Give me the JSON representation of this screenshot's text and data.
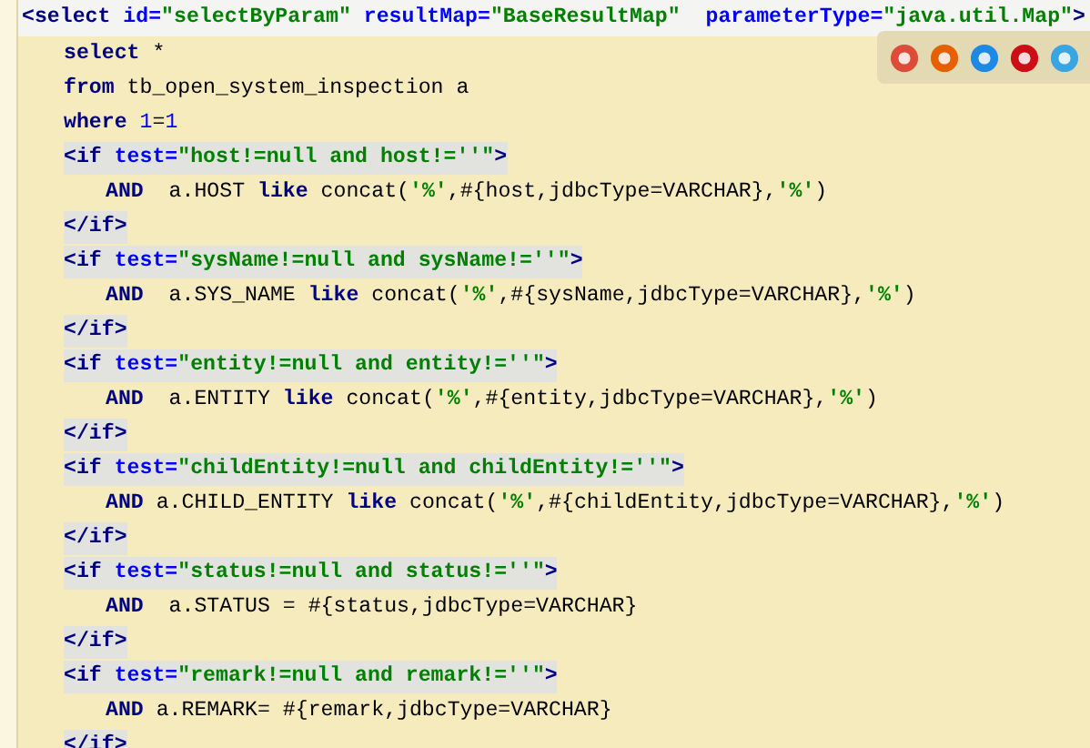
{
  "editor": {
    "lines": [
      {
        "current": true,
        "highlighted": false,
        "tokens": [
          {
            "kind": "tag",
            "text": "<select "
          },
          {
            "kind": "attr",
            "text": "id="
          },
          {
            "kind": "str",
            "text": "\"selectByParam\""
          },
          {
            "kind": "attr",
            "text": " resultMap="
          },
          {
            "kind": "str",
            "text": "\"BaseResultMap\""
          },
          {
            "kind": "attr",
            "text": "  parameterType="
          },
          {
            "kind": "str",
            "text": "\"java.util.Map\""
          },
          {
            "kind": "tag",
            "text": ">"
          }
        ],
        "children": [
          {
            "current": false,
            "highlighted": false,
            "tokens": [
              {
                "kind": "kw",
                "text": "select"
              },
              {
                "kind": "plain",
                "text": " *"
              }
            ]
          },
          {
            "current": false,
            "highlighted": false,
            "tokens": [
              {
                "kind": "kw",
                "text": "from"
              },
              {
                "kind": "plain",
                "text": " tb_open_system_inspection a"
              }
            ]
          },
          {
            "current": false,
            "highlighted": false,
            "tokens": [
              {
                "kind": "kw",
                "text": "where"
              },
              {
                "kind": "num",
                "text": " 1"
              },
              {
                "kind": "plain",
                "text": "="
              },
              {
                "kind": "num",
                "text": "1"
              }
            ]
          },
          {
            "current": false,
            "highlighted": true,
            "tokens": [
              {
                "kind": "tag",
                "text": "<if "
              },
              {
                "kind": "attr",
                "text": "test="
              },
              {
                "kind": "str",
                "text": "\"host!=null and host!=''\""
              },
              {
                "kind": "tag",
                "text": ">"
              }
            ],
            "children": [
              {
                "current": false,
                "highlighted": false,
                "tokens": [
                  {
                    "kind": "kw",
                    "text": "AND"
                  },
                  {
                    "kind": "plain",
                    "text": "  a.HOST "
                  },
                  {
                    "kind": "kw",
                    "text": "like"
                  },
                  {
                    "kind": "plain",
                    "text": " concat("
                  },
                  {
                    "kind": "str",
                    "text": "'%'"
                  },
                  {
                    "kind": "plain",
                    "text": ",#{host,jdbcType=VARCHAR},"
                  },
                  {
                    "kind": "str",
                    "text": "'%'"
                  },
                  {
                    "kind": "plain",
                    "text": ")"
                  }
                ]
              }
            ]
          },
          {
            "current": false,
            "highlighted": true,
            "tokens": [
              {
                "kind": "tag",
                "text": "</if>"
              }
            ]
          },
          {
            "current": false,
            "highlighted": true,
            "tokens": [
              {
                "kind": "tag",
                "text": "<if "
              },
              {
                "kind": "attr",
                "text": "test="
              },
              {
                "kind": "str",
                "text": "\"sysName!=null and sysName!=''\""
              },
              {
                "kind": "tag",
                "text": ">"
              }
            ],
            "children": [
              {
                "current": false,
                "highlighted": false,
                "tokens": [
                  {
                    "kind": "kw",
                    "text": "AND"
                  },
                  {
                    "kind": "plain",
                    "text": "  a.SYS_NAME "
                  },
                  {
                    "kind": "kw",
                    "text": "like"
                  },
                  {
                    "kind": "plain",
                    "text": " concat("
                  },
                  {
                    "kind": "str",
                    "text": "'%'"
                  },
                  {
                    "kind": "plain",
                    "text": ",#{sysName,jdbcType=VARCHAR},"
                  },
                  {
                    "kind": "str",
                    "text": "'%'"
                  },
                  {
                    "kind": "plain",
                    "text": ")"
                  }
                ]
              }
            ]
          },
          {
            "current": false,
            "highlighted": true,
            "tokens": [
              {
                "kind": "tag",
                "text": "</if>"
              }
            ]
          },
          {
            "current": false,
            "highlighted": true,
            "tokens": [
              {
                "kind": "tag",
                "text": "<if "
              },
              {
                "kind": "attr",
                "text": "test="
              },
              {
                "kind": "str",
                "text": "\"entity!=null and entity!=''\""
              },
              {
                "kind": "tag",
                "text": ">"
              }
            ],
            "children": [
              {
                "current": false,
                "highlighted": false,
                "tokens": [
                  {
                    "kind": "kw",
                    "text": "AND"
                  },
                  {
                    "kind": "plain",
                    "text": "  a.ENTITY "
                  },
                  {
                    "kind": "kw",
                    "text": "like"
                  },
                  {
                    "kind": "plain",
                    "text": " concat("
                  },
                  {
                    "kind": "str",
                    "text": "'%'"
                  },
                  {
                    "kind": "plain",
                    "text": ",#{entity,jdbcType=VARCHAR},"
                  },
                  {
                    "kind": "str",
                    "text": "'%'"
                  },
                  {
                    "kind": "plain",
                    "text": ")"
                  }
                ]
              }
            ]
          },
          {
            "current": false,
            "highlighted": true,
            "tokens": [
              {
                "kind": "tag",
                "text": "</if>"
              }
            ]
          },
          {
            "current": false,
            "highlighted": true,
            "tokens": [
              {
                "kind": "tag",
                "text": "<if "
              },
              {
                "kind": "attr",
                "text": "test="
              },
              {
                "kind": "str",
                "text": "\"childEntity!=null and childEntity!=''\""
              },
              {
                "kind": "tag",
                "text": ">"
              }
            ],
            "children": [
              {
                "current": false,
                "highlighted": false,
                "tokens": [
                  {
                    "kind": "kw",
                    "text": "AND"
                  },
                  {
                    "kind": "plain",
                    "text": " a.CHILD_ENTITY "
                  },
                  {
                    "kind": "kw",
                    "text": "like"
                  },
                  {
                    "kind": "plain",
                    "text": " concat("
                  },
                  {
                    "kind": "str",
                    "text": "'%'"
                  },
                  {
                    "kind": "plain",
                    "text": ",#{childEntity,jdbcType=VARCHAR},"
                  },
                  {
                    "kind": "str",
                    "text": "'%'"
                  },
                  {
                    "kind": "plain",
                    "text": ")"
                  }
                ]
              }
            ]
          },
          {
            "current": false,
            "highlighted": true,
            "tokens": [
              {
                "kind": "tag",
                "text": "</if>"
              }
            ]
          },
          {
            "current": false,
            "highlighted": true,
            "tokens": [
              {
                "kind": "tag",
                "text": "<if "
              },
              {
                "kind": "attr",
                "text": "test="
              },
              {
                "kind": "str",
                "text": "\"status!=null and status!=''\""
              },
              {
                "kind": "tag",
                "text": ">"
              }
            ],
            "children": [
              {
                "current": false,
                "highlighted": false,
                "tokens": [
                  {
                    "kind": "kw",
                    "text": "AND"
                  },
                  {
                    "kind": "plain",
                    "text": "  a.STATUS = #{status,jdbcType=VARCHAR}"
                  }
                ]
              }
            ]
          },
          {
            "current": false,
            "highlighted": true,
            "tokens": [
              {
                "kind": "tag",
                "text": "</if>"
              }
            ]
          },
          {
            "current": false,
            "highlighted": true,
            "tokens": [
              {
                "kind": "tag",
                "text": "<if "
              },
              {
                "kind": "attr",
                "text": "test="
              },
              {
                "kind": "str",
                "text": "\"remark!=null and remark!=''\""
              },
              {
                "kind": "tag",
                "text": ">"
              }
            ],
            "children": [
              {
                "current": false,
                "highlighted": false,
                "tokens": [
                  {
                    "kind": "kw",
                    "text": "AND"
                  },
                  {
                    "kind": "plain",
                    "text": " a.REMARK= #{remark,jdbcType=VARCHAR}"
                  }
                ]
              }
            ]
          },
          {
            "current": false,
            "highlighted": true,
            "tokens": [
              {
                "kind": "tag",
                "text": "</if>"
              }
            ]
          }
        ]
      }
    ]
  },
  "browser_icons": [
    {
      "color": "#dd4b39"
    },
    {
      "color": "#e66000"
    },
    {
      "color": "#1e88e5"
    },
    {
      "color": "#cc0f16"
    },
    {
      "color": "#3aa5e0"
    }
  ]
}
